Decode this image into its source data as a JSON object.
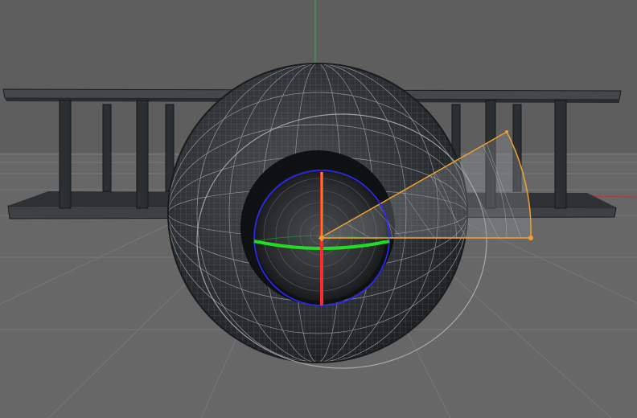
{
  "viewport": {
    "view": "perspective",
    "colors": {
      "background": "#5e5e5e",
      "floor": "#6a6a6a",
      "grid": "#7a7a7a",
      "y_axis": "#3fae3f",
      "x_axis": "#c03030",
      "object_dark": "#2a2c2e",
      "wire": "#8a8e92",
      "gizmo_red": "#ff2a2a",
      "gizmo_green": "#22dd22",
      "gizmo_blue": "#2a2aff",
      "gizmo_orange": "#f0a030"
    },
    "objects": [
      {
        "name": "table-frame",
        "icon": "cube-icon"
      },
      {
        "name": "sphere",
        "icon": "sphere-icon"
      }
    ],
    "gizmo": {
      "mode": "rotate",
      "handles": [
        "x-axis-handle",
        "y-axis-handle",
        "z-axis-handle",
        "angle-sector-handle"
      ]
    }
  }
}
